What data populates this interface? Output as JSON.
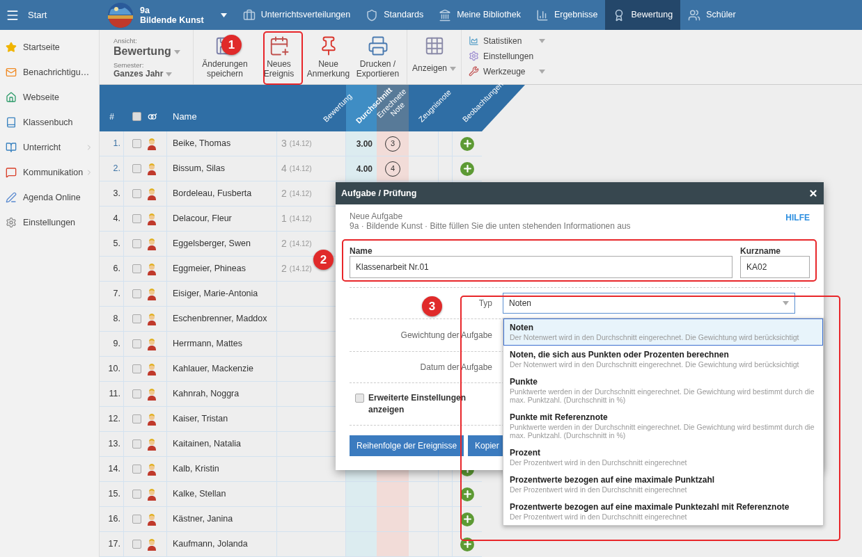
{
  "top_bar": {
    "menu_label": "Start",
    "class_name": "9a",
    "subject": "Bildende Kunst",
    "nav": [
      {
        "label": "Unterrichtsverteilungen",
        "selected": false
      },
      {
        "label": "Standards",
        "selected": false
      },
      {
        "label": "Meine Bibliothek",
        "selected": false
      },
      {
        "label": "Ergebnisse",
        "selected": false
      },
      {
        "label": "Bewertung",
        "selected": true
      },
      {
        "label": "Schüler",
        "selected": false
      }
    ]
  },
  "sidebar": {
    "items": [
      {
        "label": "Startseite",
        "has_submenu": false
      },
      {
        "label": "Benachrichtigu…",
        "has_submenu": false
      },
      {
        "label": "Webseite",
        "has_submenu": false
      },
      {
        "label": "Klassenbuch",
        "has_submenu": false
      },
      {
        "label": "Unterricht",
        "has_submenu": true
      },
      {
        "label": "Kommunikation",
        "has_submenu": true
      },
      {
        "label": "Agenda Online",
        "has_submenu": false
      },
      {
        "label": "Einstellungen",
        "has_submenu": false
      }
    ]
  },
  "toolbar": {
    "view_label": "Ansicht:",
    "view_value": "Bewertung",
    "semester_label": "Semester:",
    "semester_value": "Ganzes Jahr",
    "buttons": [
      {
        "lines": [
          "Änderungen",
          "speichern"
        ],
        "dropdown": false
      },
      {
        "lines": [
          "Neues",
          "Ereignis"
        ],
        "dropdown": false
      },
      {
        "lines": [
          "Neue",
          "Anmerkung"
        ],
        "dropdown": false
      },
      {
        "lines": [
          "Drucken /",
          "Exportieren"
        ],
        "dropdown": false
      },
      {
        "lines": [
          "Anzeigen"
        ],
        "dropdown": true
      }
    ],
    "menu": [
      {
        "label": "Statistiken",
        "dropdown": true
      },
      {
        "label": "Einstellungen",
        "dropdown": false
      },
      {
        "label": "Werkzeuge",
        "dropdown": true
      }
    ]
  },
  "table": {
    "select_all_checked": false,
    "columns": [
      "#",
      "Name",
      "Bewertung",
      "Durchschnitt",
      "Errechnete Note",
      "Zeugnisnote",
      "Beobachtungen"
    ],
    "rows": [
      {
        "number": "1.",
        "name": "Beike, Thomas",
        "checked": false,
        "grade": "3",
        "grade_date": "(14.12)",
        "average": "3.00",
        "computed_grade": "3",
        "add_button": true
      },
      {
        "number": "2.",
        "name": "Bissum, Silas",
        "checked": false,
        "grade": "4",
        "grade_date": "(14.12)",
        "average": "4.00",
        "computed_grade": "4",
        "add_button": true
      },
      {
        "number": "3.",
        "name": "Bordeleau, Fusberta",
        "checked": false,
        "grade": "2",
        "grade_date": "(14.12)",
        "add_button": false
      },
      {
        "number": "4.",
        "name": "Delacour, Fleur",
        "checked": false,
        "grade": "1",
        "grade_date": "(14.12)",
        "add_button": false
      },
      {
        "number": "5.",
        "name": "Eggelsberger, Swen",
        "checked": false,
        "grade": "2",
        "grade_date": "(14.12)",
        "add_button": false
      },
      {
        "number": "6.",
        "name": "Eggmeier, Phineas",
        "checked": false,
        "grade": "2",
        "grade_date": "(14.12)",
        "add_button": false
      },
      {
        "number": "7.",
        "name": "Eisiger, Marie-Antonia",
        "checked": false,
        "add_button": false
      },
      {
        "number": "8.",
        "name": "Eschenbrenner, Maddox",
        "checked": false,
        "add_button": false
      },
      {
        "number": "9.",
        "name": "Herrmann, Mattes",
        "checked": false,
        "add_button": false
      },
      {
        "number": "10.",
        "name": "Kahlauer, Mackenzie",
        "checked": false,
        "add_button": false
      },
      {
        "number": "11.",
        "name": "Kahnrah, Noggra",
        "checked": false,
        "add_button": false
      },
      {
        "number": "12.",
        "name": "Kaiser, Tristan",
        "checked": false,
        "add_button": false
      },
      {
        "number": "13.",
        "name": "Kaitainen, Natalia",
        "checked": false,
        "add_button": false
      },
      {
        "number": "14.",
        "name": "Kalb, Kristin",
        "checked": false,
        "add_button": true
      },
      {
        "number": "15.",
        "name": "Kalke, Stellan",
        "checked": false,
        "add_button": true
      },
      {
        "number": "16.",
        "name": "Kästner, Janina",
        "checked": false,
        "add_button": true
      },
      {
        "number": "17.",
        "name": "Kaufmann, Jolanda",
        "checked": false,
        "add_button": true
      }
    ]
  },
  "dialog": {
    "title": "Aufgabe / Prüfung",
    "heading": "Neue Aufgabe",
    "subtitle": "9a · Bildende Kunst · Bitte füllen Sie die unten stehenden Informationen aus",
    "help_link": "HILFE",
    "name": {
      "label": "Name",
      "value": "Klassenarbeit Nr.01"
    },
    "short_name": {
      "label": "Kurzname",
      "value": "KA02"
    },
    "type": {
      "label": "Typ",
      "value": "Noten"
    },
    "weight_label": "Gewichtung der Aufgabe",
    "date_label": "Datum der Aufgabe",
    "advanced": {
      "label": "Erweiterte Einstellungen anzeigen",
      "checked": false
    },
    "buttons": [
      "Reihenfolge der Ereignisse",
      "Kopier"
    ],
    "type_options": [
      {
        "title": "Noten",
        "description": "Der Notenwert wird in den Durchschnitt eingerechnet. Die Gewichtung wird berücksichtigt",
        "selected": true
      },
      {
        "title": "Noten, die sich aus Punkten oder Prozenten berechnen",
        "description": "Der Notenwert wird in den Durchschnitt eingerechnet. Die Gewichtung wird berücksichtigt",
        "selected": false
      },
      {
        "title": "Punkte",
        "description": "Punktwerte werden in der Durchschnitt eingerechnet. Die Gewichtung wird bestimmt durch die max. Punktzahl. (Durchschnitt in %)",
        "selected": false
      },
      {
        "title": "Punkte mit Referenznote",
        "description": "Punktwerte werden in der Durchschnitt eingerechnet. Die Gewichtung wird bestimmt durch die max. Punktzahl. (Durchschnitt in %)",
        "selected": false
      },
      {
        "title": "Prozent",
        "description": "Der Prozentwert wird in den Durchschnitt eingerechnet",
        "selected": false
      },
      {
        "title": "Prozentwerte bezogen auf eine maximale Punktzahl",
        "description": "Der Prozentwert wird in den Durchschnitt eingerechnet",
        "selected": false
      },
      {
        "title": "Prozentwerte bezogen auf eine maximale Punktezahl mit Referenznote",
        "description": "Der Prozentwert wird in den Durchschnitt eingerechnet",
        "selected": false
      }
    ]
  },
  "annotations": [
    {
      "number": "1"
    },
    {
      "number": "2"
    },
    {
      "number": "3"
    }
  ]
}
